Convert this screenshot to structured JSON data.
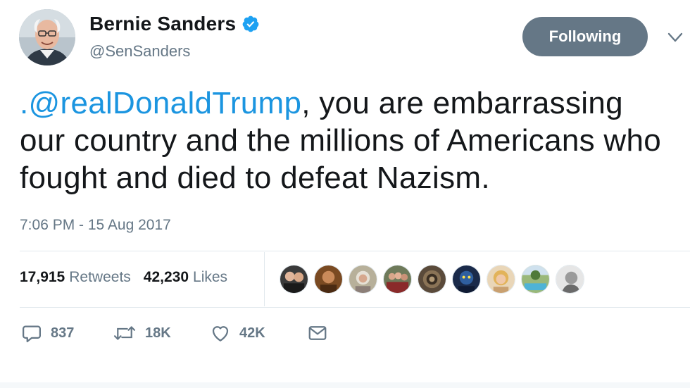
{
  "user": {
    "display_name": "Bernie Sanders",
    "handle": "@SenSanders",
    "verified": true,
    "avatar_icon": "profile-photo"
  },
  "follow_button": {
    "label": "Following",
    "color": "#657786"
  },
  "menu_icon": "chevron-down-icon",
  "tweet": {
    "mention": ".@realDonaldTrump",
    "text": ", you are embarrassing our country and the millions of Americans who fought and died to defeat Nazism.",
    "timestamp": "7:06 PM - 15 Aug 2017"
  },
  "stats": {
    "retweets_count": "17,915",
    "retweets_label": "Retweets",
    "likes_count": "42,230",
    "likes_label": "Likes"
  },
  "liked_by": [
    {
      "icon": "avatar-couple"
    },
    {
      "icon": "avatar-portrait"
    },
    {
      "icon": "avatar-woman"
    },
    {
      "icon": "avatar-group"
    },
    {
      "icon": "avatar-pattern"
    },
    {
      "icon": "avatar-blue"
    },
    {
      "icon": "avatar-blonde"
    },
    {
      "icon": "avatar-pool"
    },
    {
      "icon": "avatar-grey"
    }
  ],
  "actions": {
    "reply_count": "837",
    "retweet_count": "18K",
    "like_count": "42K"
  },
  "colors": {
    "link": "#1b95e0",
    "secondary_text": "#657786",
    "primary_text": "#14171a",
    "verified": "#1da1f2"
  }
}
